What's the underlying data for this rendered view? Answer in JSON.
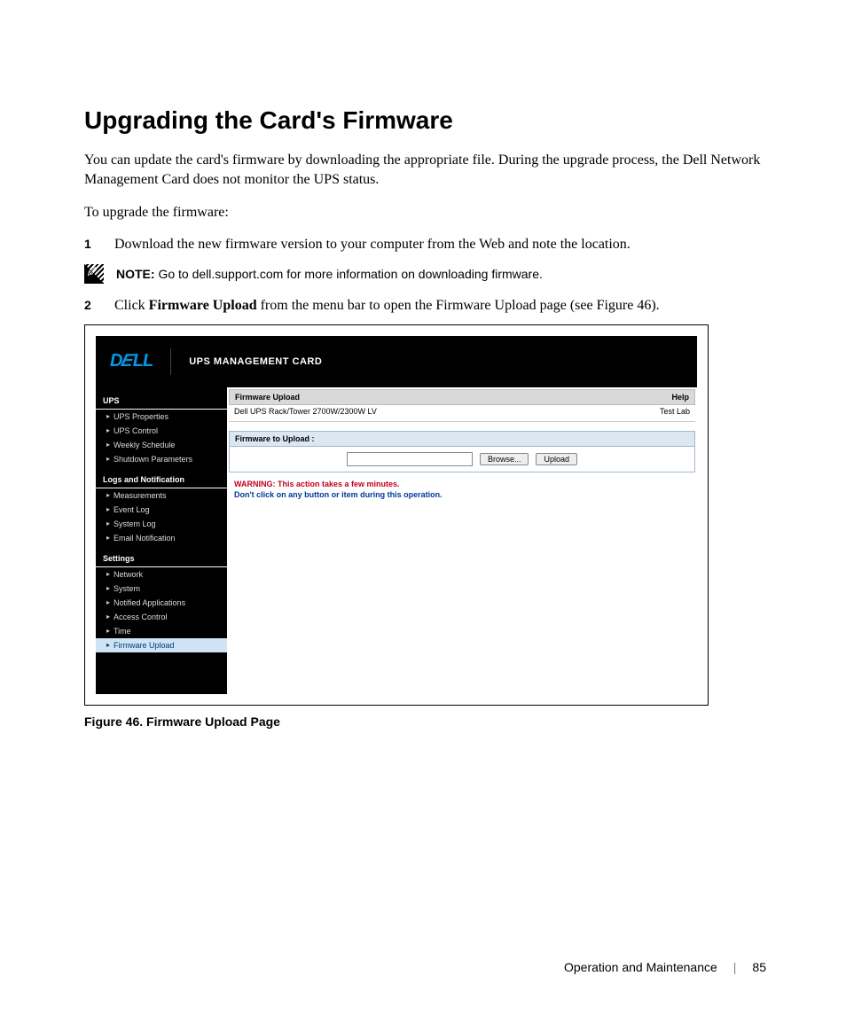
{
  "heading": "Upgrading the Card's Firmware",
  "intro": "You can update the card's firmware by downloading the appropriate file. During the upgrade process, the Dell Network Management Card does not monitor the UPS status.",
  "lead_in": "To upgrade the firmware:",
  "steps": {
    "s1_num": "1",
    "s1_text": "Download the new firmware version to your computer from the Web and note the location.",
    "s2_num": "2",
    "s2_pre": "Click ",
    "s2_bold": "Firmware Upload",
    "s2_post": " from the menu bar to open the Firmware Upload page (see Figure 46)."
  },
  "note": {
    "label": "NOTE:",
    "text": " Go to dell.support.com for more information on downloading firmware."
  },
  "app": {
    "logo": "DELL",
    "title": "UPS MANAGEMENT CARD",
    "sidebar": {
      "sec1": "UPS",
      "sec1_items": [
        "UPS Properties",
        "UPS Control",
        "Weekly Schedule",
        "Shutdown Parameters"
      ],
      "sec2": "Logs and Notification",
      "sec2_items": [
        "Measurements",
        "Event Log",
        "System Log",
        "Email Notification"
      ],
      "sec3": "Settings",
      "sec3_items": [
        "Network",
        "System",
        "Notified Applications",
        "Access Control",
        "Time",
        "Firmware Upload"
      ]
    },
    "main": {
      "panel_title": "Firmware Upload",
      "help": "Help",
      "device": "Dell UPS Rack/Tower 2700W/2300W LV",
      "lab": "Test Lab",
      "section": "Firmware to Upload :",
      "browse": "Browse...",
      "upload": "Upload",
      "warn1": "WARNING: This action takes a few minutes.",
      "warn2": "Don't click on any button or item during this operation."
    }
  },
  "figure_caption": "Figure 46. Firmware Upload Page",
  "footer": {
    "section": "Operation and Maintenance",
    "page": "85"
  }
}
